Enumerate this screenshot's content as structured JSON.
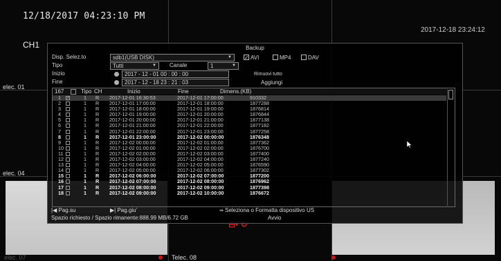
{
  "osd": {
    "datetime": "12/18/2017 04:23:10 PM",
    "datetime_right": "2017-12-18 23:24:12",
    "channel": "CH1",
    "cam_labels": [
      "elec. 01",
      "elec. 04",
      "elec. 07",
      "Telec. 08"
    ]
  },
  "dialog": {
    "title": "Backup",
    "device_label": "Disp. Selez.to",
    "device_value": "sdb1(USB DISK)",
    "formats": [
      "AVI",
      "MP4",
      "DAV"
    ],
    "format_checked": [
      "✓",
      "",
      ""
    ],
    "type_label": "Tipo",
    "type_value": "Tutti",
    "channel_label": "Canale",
    "channel_value": "1",
    "start_label": "Inizio",
    "start_value": "2017 - 12 - 01   00 : 00 : 00",
    "end_label": "Fine",
    "end_value": "2017 - 12 - 18   23 : 21 : 03",
    "remove_all": "Rimuovi tutto",
    "add": "Aggiungi",
    "table": {
      "headers": [
        "167",
        "Tipo",
        "CH",
        "Inizio",
        "Fine",
        "Dimens.(KB)"
      ],
      "rows": [
        {
          "n": "1",
          "chk": "✓",
          "type": "1",
          "ch": "R",
          "start": "2017-12-01 16:30:53",
          "end": "2017-12-01 17:00:00",
          "size": "910332"
        },
        {
          "n": "2",
          "chk": "",
          "type": "1",
          "ch": "R",
          "start": "2017-12-01 17:00:00",
          "end": "2017-12-01 18:00:00",
          "size": "1877288"
        },
        {
          "n": "3",
          "chk": "",
          "type": "1",
          "ch": "R",
          "start": "2017-12-01 18:00:00",
          "end": "2017-12-01 19:00:00",
          "size": "1876814"
        },
        {
          "n": "4",
          "chk": "",
          "type": "1",
          "ch": "R",
          "start": "2017-12-01 19:00:00",
          "end": "2017-12-01 20:00:00",
          "size": "1876844"
        },
        {
          "n": "5",
          "chk": "",
          "type": "1",
          "ch": "R",
          "start": "2017-12-01 20:00:00",
          "end": "2017-12-01 21:00:00",
          "size": "1877138"
        },
        {
          "n": "6",
          "chk": "",
          "type": "1",
          "ch": "R",
          "start": "2017-12-01 21:00:00",
          "end": "2017-12-01 22:00:00",
          "size": "1877182"
        },
        {
          "n": "7",
          "chk": "",
          "type": "1",
          "ch": "R",
          "start": "2017-12-01 22:00:00",
          "end": "2017-12-01 23:00:00",
          "size": "1877258"
        },
        {
          "n": "8",
          "chk": "",
          "type": "1",
          "ch": "R",
          "start": "2017-12-01 23:00:00",
          "end": "2017-12-02 00:00:00",
          "size": "1876348"
        },
        {
          "n": "9",
          "chk": "",
          "type": "1",
          "ch": "R",
          "start": "2017-12-02 00:00:00",
          "end": "2017-12-02 01:00:00",
          "size": "1877362"
        },
        {
          "n": "10",
          "chk": "",
          "type": "1",
          "ch": "R",
          "start": "2017-12-02 01:00:00",
          "end": "2017-12-02 02:00:00",
          "size": "1876700"
        },
        {
          "n": "11",
          "chk": "",
          "type": "1",
          "ch": "R",
          "start": "2017-12-02 02:00:00",
          "end": "2017-12-02 03:00:00",
          "size": "1877400"
        },
        {
          "n": "12",
          "chk": "",
          "type": "1",
          "ch": "R",
          "start": "2017-12-02 03:00:00",
          "end": "2017-12-02 04:00:00",
          "size": "1877240"
        },
        {
          "n": "13",
          "chk": "",
          "type": "1",
          "ch": "R",
          "start": "2017-12-02 04:00:00",
          "end": "2017-12-02 05:00:00",
          "size": "1876590"
        },
        {
          "n": "14",
          "chk": "",
          "type": "1",
          "ch": "R",
          "start": "2017-12-02 05:00:00",
          "end": "2017-12-02 06:00:00",
          "size": "1877302"
        },
        {
          "n": "15",
          "chk": "",
          "type": "1",
          "ch": "R",
          "start": "2017-12-02 06:00:00",
          "end": "2017-12-02 07:00:00",
          "size": "1877200"
        },
        {
          "n": "16",
          "chk": "",
          "type": "1",
          "ch": "R",
          "start": "2017-12-02 07:00:00",
          "end": "2017-12-02 08:00:00",
          "size": "1876962"
        },
        {
          "n": "17",
          "chk": "",
          "type": "1",
          "ch": "R",
          "start": "2017-12-02 08:00:00",
          "end": "2017-12-02 09:00:00",
          "size": "1877398"
        },
        {
          "n": "18",
          "chk": "",
          "type": "1",
          "ch": "R",
          "start": "2017-12-02 09:00:00",
          "end": "2017-12-02 10:00:00",
          "size": "1876672"
        }
      ]
    },
    "page_up": "Pag.su",
    "page_down": "Pag.giu'",
    "format_device": "Seleziona o Formatta dispositivo US",
    "space_label": "Spazio richiesto / Spazio rimanente:888.99 MB/6.72 GB",
    "start_button": "Avvio"
  }
}
